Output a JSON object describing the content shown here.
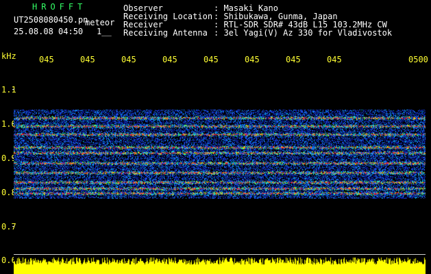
{
  "header": {
    "program": "HROFFT",
    "filename": "UT2508080450.pn",
    "meteor_label": "meteor",
    "timestamp": "25.08.08 04:50",
    "counter": "1__"
  },
  "info": [
    {
      "label": "Observer",
      "value": ": Masaki Kano"
    },
    {
      "label": "Receiving Location",
      "value": ": Shibukawa, Gunma, Japan"
    },
    {
      "label": "Receiver",
      "value": ": RTL-SDR SDR# 43dB L15 103.2MHz CW"
    },
    {
      "label": "Receiving Antenna",
      "value": ": 3el Yagi(V) Az 330 for Vladivostok"
    }
  ],
  "axis": {
    "unit": "kHz",
    "y_ticks": [
      "1.1",
      "1.0",
      "0.9",
      "0.8",
      "0.7",
      "0.6"
    ],
    "x_ticks": [
      "045",
      "045",
      "045",
      "045",
      "045",
      "045",
      "045",
      "045",
      "0500"
    ]
  },
  "colors": {
    "background": "#000000",
    "title": "#33ff66",
    "time_labels": "#ffff33",
    "amplitude": "#ffff00"
  }
}
